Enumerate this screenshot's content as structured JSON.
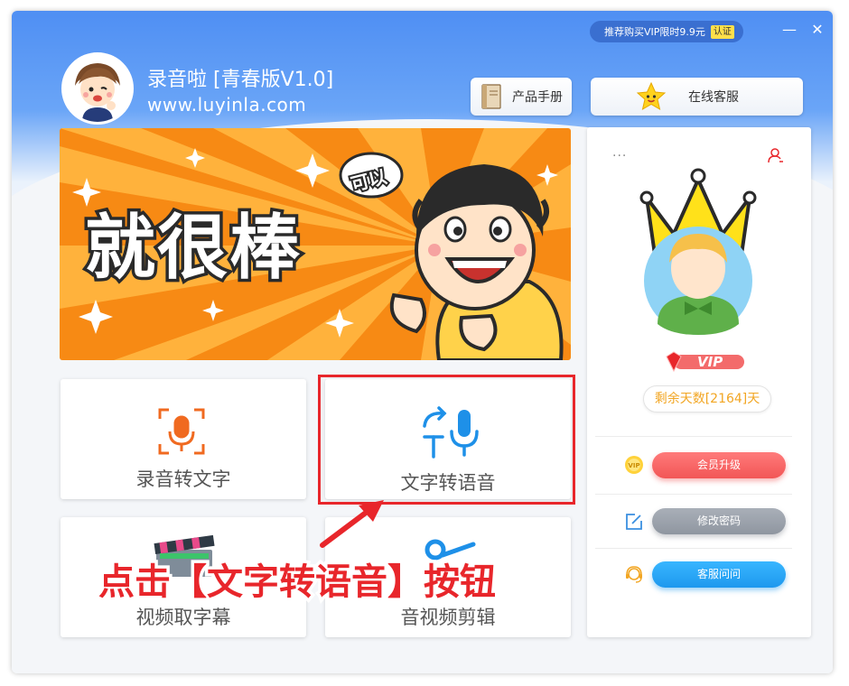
{
  "titlebar": {
    "vip_promo": "推荐购买VIP限时9.9元",
    "vip_promo_tag": "认证",
    "minimize_label": "—",
    "close_label": "✕"
  },
  "header": {
    "title": "录音啦  [青春版V1.0]",
    "url": "www.luyinla.com",
    "manual_label": "产品手册",
    "service_label": "在线客服"
  },
  "banner": {
    "headline": "就很棒",
    "tag": "可以"
  },
  "features": [
    {
      "label": "录音转文字",
      "icon": "recording-to-text-icon"
    },
    {
      "label": "文字转语音",
      "icon": "text-to-speech-icon"
    },
    {
      "label": "视频取字幕",
      "icon": "video-subtitle-icon"
    },
    {
      "label": "音视频剪辑",
      "icon": "av-edit-icon"
    }
  ],
  "callout": "点击【文字转语音】按钮",
  "panel": {
    "menu_dots": "···",
    "vip_label": "VIP",
    "remaining_days": "剩余天数[2164]天",
    "upgrade_label": "会员升级",
    "change_password_label": "修改密码",
    "support_label": "客服问问"
  },
  "colors": {
    "accent_blue": "#4f8ff3",
    "highlight_red": "#e8262b",
    "days_orange": "#f2a623"
  }
}
